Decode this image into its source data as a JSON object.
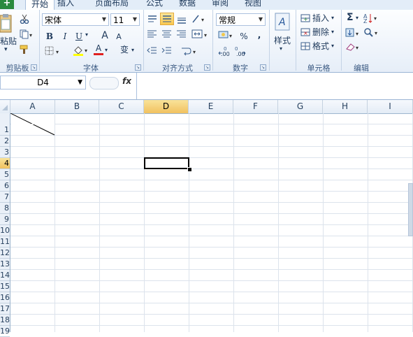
{
  "tabs": [
    {
      "label": "开始",
      "active": true
    },
    {
      "label": "插入"
    },
    {
      "label": "页面布局"
    },
    {
      "label": "公式"
    },
    {
      "label": "数据"
    },
    {
      "label": "审阅"
    },
    {
      "label": "视图"
    }
  ],
  "file_button": "+",
  "clipboard": {
    "paste_label": "粘贴",
    "group_label": "剪贴板"
  },
  "font": {
    "name": "宋体",
    "size": "11",
    "bold": "B",
    "italic": "I",
    "underline": "U",
    "grow": "A",
    "shrink": "A",
    "font_color": "A",
    "phonetic": "变",
    "group_label": "字体"
  },
  "alignment": {
    "group_label": "对齐方式"
  },
  "number": {
    "format": "常规",
    "percent": "%",
    "comma": ",",
    "inc_decimal": ".00",
    "dec_decimal": ".00",
    "group_label": "数字"
  },
  "styles": {
    "label": "样式"
  },
  "cells": {
    "insert": "插入",
    "delete": "删除",
    "format": "格式",
    "group_label": "单元格"
  },
  "editing": {
    "sum": "Σ",
    "group_label": "编辑"
  },
  "formula_bar": {
    "name_box": "D4",
    "fx": "fx"
  },
  "columns": [
    "A",
    "B",
    "C",
    "D",
    "E",
    "F",
    "G",
    "H",
    "I"
  ],
  "active_column": "D",
  "rows": [
    "1",
    "2",
    "3",
    "4",
    "5",
    "6",
    "7",
    "8",
    "9",
    "10",
    "11",
    "12",
    "13",
    "14",
    "15",
    "16",
    "17",
    "18",
    "19"
  ],
  "active_row": "4"
}
